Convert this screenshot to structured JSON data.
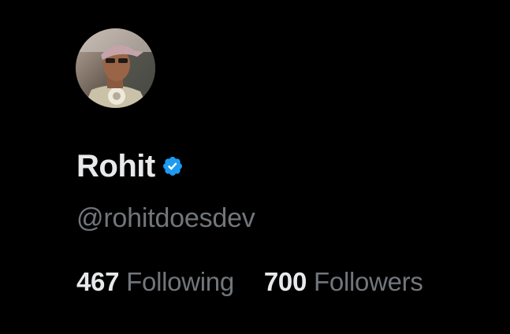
{
  "profile": {
    "display_name": "Rohit",
    "handle": "@rohitdoesdev",
    "verified_icon": "verified-badge-icon",
    "avatar_icon": "profile-photo",
    "stats": {
      "following_count": "467",
      "following_label": "Following",
      "followers_count": "700",
      "followers_label": "Followers"
    }
  },
  "colors": {
    "background": "#000000",
    "primary_text": "#e7e9ea",
    "secondary_text": "#71767b",
    "verified_blue": "#1d9bf0"
  }
}
